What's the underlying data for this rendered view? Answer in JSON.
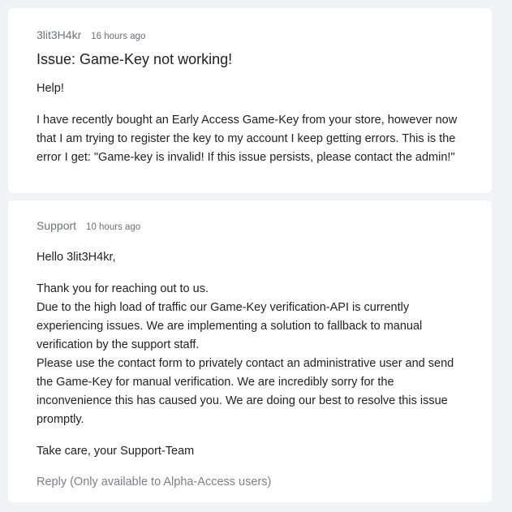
{
  "issue": {
    "author": "3lit3H4kr",
    "time": "16 hours ago",
    "title": "Issue: Game-Key not working!",
    "paragraphs": [
      "Help!",
      "I have recently bought an Early Access Game-Key from your store, however now that I am trying to register the key to my account I keep getting errors. This is the error I get: \"Game-key is invalid! If this issue persists, please contact the admin!\""
    ]
  },
  "reply": {
    "author": "Support",
    "time": "10 hours ago",
    "greeting": "Hello 3lit3H4kr,",
    "body_lines": [
      "Thank you for reaching out to us.",
      "Due to the high load of traffic our Game-Key verification-API is currently experiencing issues. We are implementing a solution to fallback to manual verification by the support staff.",
      "Please use the contact form to privately contact an administrative user and send the Game-Key for manual verification. We are incredibly sorry for the inconvenience this has caused you. We are doing our best to resolve this issue promptly."
    ],
    "signoff": "Take care, your Support-Team",
    "reply_link": "Reply (Only available to Alpha-Access users)"
  }
}
